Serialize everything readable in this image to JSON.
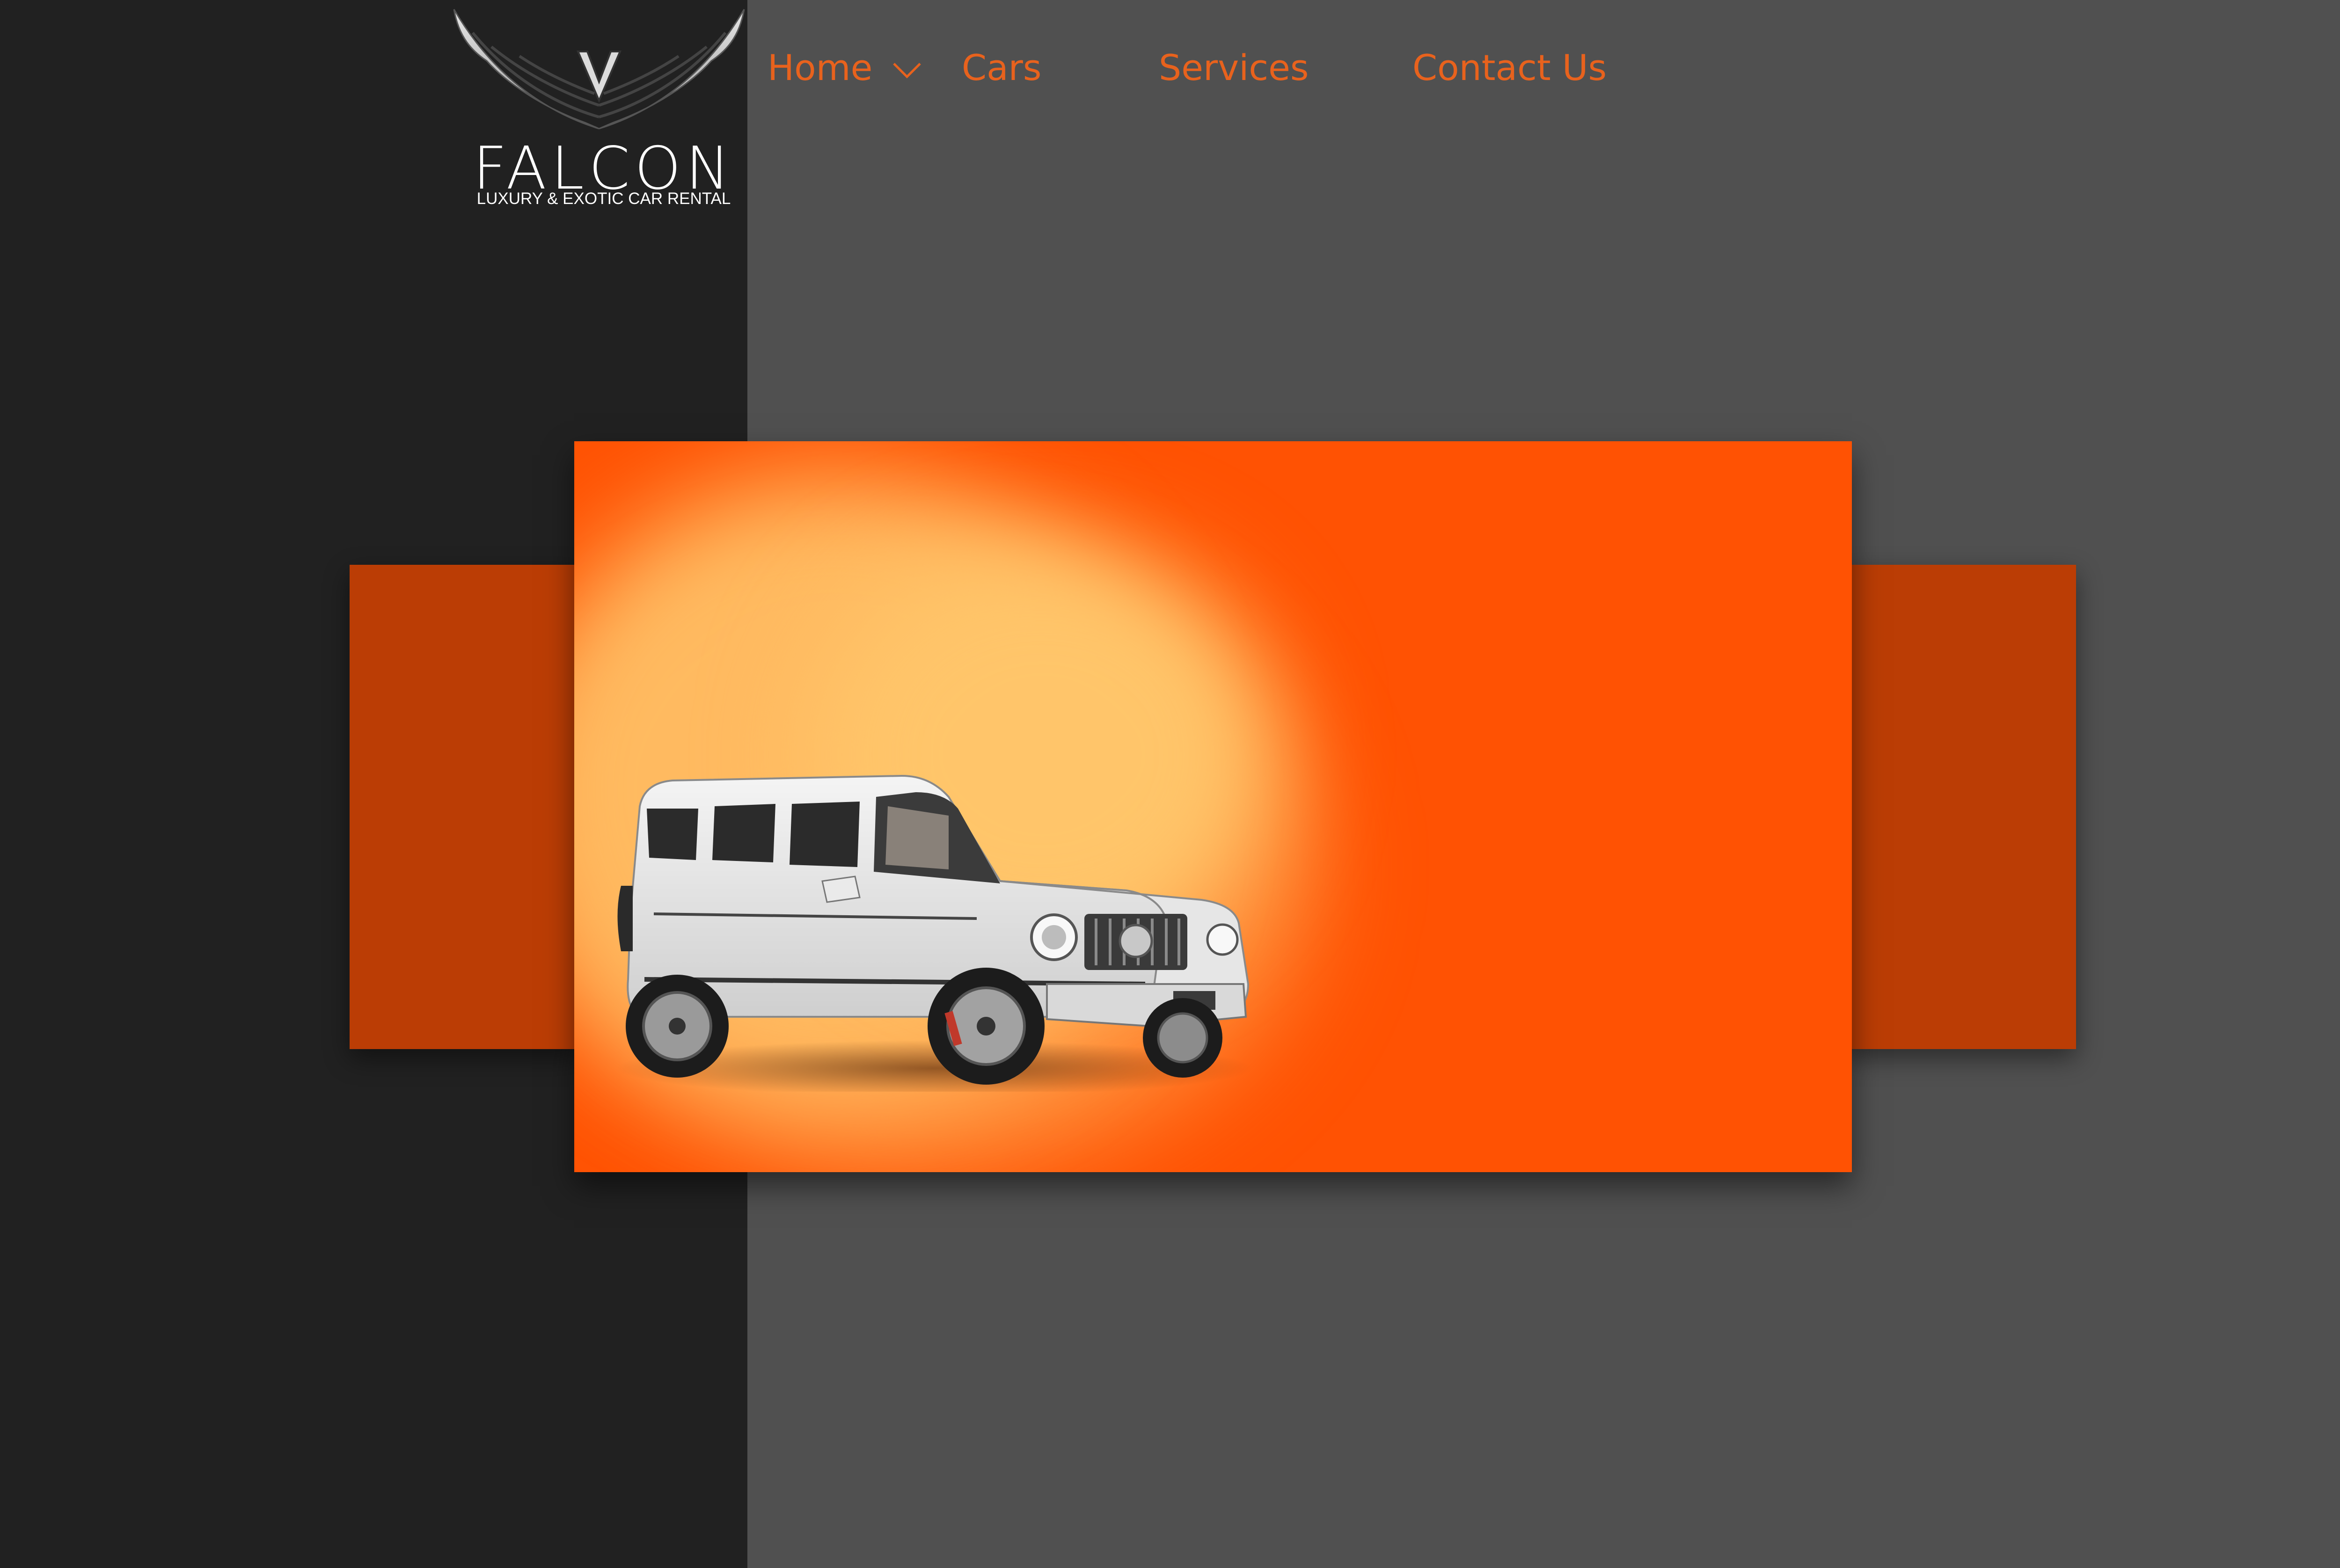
{
  "brand": {
    "name": "FALCON",
    "tagline": "LUXURY & EXOTIC CAR RENTAL",
    "logo_icon": "falcon-wings-icon"
  },
  "nav": {
    "items": [
      {
        "label": "Home",
        "has_dropdown": true
      },
      {
        "label": "Cars"
      },
      {
        "label": "Services"
      },
      {
        "label": "Contact Us"
      }
    ]
  },
  "hero": {
    "image": "white-suv-image"
  },
  "colors": {
    "nav_text": "#e8621d",
    "hero_orange": "#ff5203",
    "side_panels": "#bb3d05",
    "left_panel": "#212121",
    "page_bg": "#505050"
  }
}
